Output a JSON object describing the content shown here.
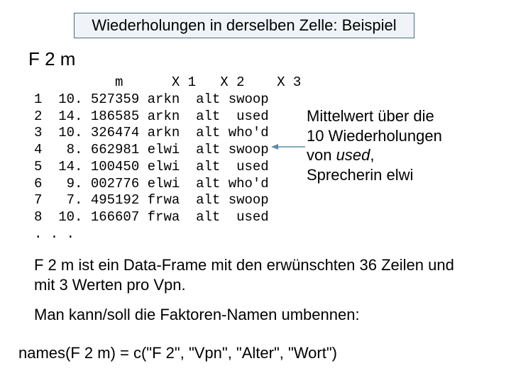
{
  "title": "Wiederholungen in derselben Zelle: Beispiel",
  "heading": "F 2 m",
  "table": {
    "header": {
      "c1": "m",
      "c2": "X 1",
      "c3": "X 2",
      "c4": "X 3"
    },
    "rows": [
      {
        "n": "1",
        "m": "10. 527359",
        "x1": "arkn",
        "x2": "alt",
        "x3": "swoop"
      },
      {
        "n": "2",
        "m": "14. 186585",
        "x1": "arkn",
        "x2": "alt",
        "x3": " used"
      },
      {
        "n": "3",
        "m": "10. 326474",
        "x1": "arkn",
        "x2": "alt",
        "x3": "who'd"
      },
      {
        "n": "4",
        "m": " 8. 662981",
        "x1": "elwi",
        "x2": "alt",
        "x3": "swoop"
      },
      {
        "n": "5",
        "m": "14. 100450",
        "x1": "elwi",
        "x2": "alt",
        "x3": " used"
      },
      {
        "n": "6",
        "m": " 9. 002776",
        "x1": "elwi",
        "x2": "alt",
        "x3": "who'd"
      },
      {
        "n": "7",
        "m": " 7. 495192",
        "x1": "frwa",
        "x2": "alt",
        "x3": "swoop"
      },
      {
        "n": "8",
        "m": "10. 166607",
        "x1": "frwa",
        "x2": "alt",
        "x3": " used"
      }
    ],
    "ellipsis": ". . ."
  },
  "annotation": {
    "l1": "Mittelwert über die",
    "l2": "10 Wiederholungen",
    "l3a": "von ",
    "l3b": "used",
    "l3c": ",",
    "l4": "Sprecherin elwi"
  },
  "para1": "F 2 m ist ein Data-Frame mit den erwünschten 36 Zeilen und mit 3 Werten pro Vpn.",
  "para2": "Man kann/soll die Faktoren-Namen umbennen:",
  "code": "names(F 2 m) = c(\"F 2\", \"Vpn\", \"Alter\", \"Wort\")"
}
